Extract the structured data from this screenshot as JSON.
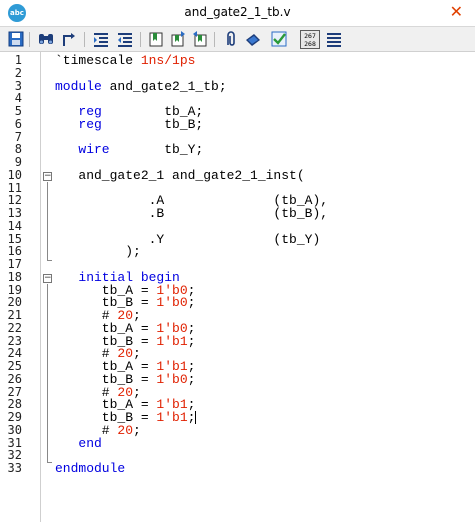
{
  "window": {
    "title": "and_gate2_1_tb.v",
    "app_icon_label": "abc"
  },
  "toolbar": {
    "counter_top": "267",
    "counter_bottom": "268"
  },
  "editor": {
    "line_numbers": [
      "1",
      "2",
      "3",
      "4",
      "5",
      "6",
      "7",
      "8",
      "9",
      "10",
      "11",
      "12",
      "13",
      "14",
      "15",
      "16",
      "17",
      "18",
      "19",
      "20",
      "21",
      "22",
      "23",
      "24",
      "25",
      "26",
      "27",
      "28",
      "29",
      "30",
      "31",
      "32",
      "33"
    ],
    "lines": [
      [
        {
          "t": "`timescale "
        },
        {
          "t": "1ns/1ps",
          "c": "num"
        }
      ],
      [],
      [
        {
          "t": "module",
          "c": "kw"
        },
        {
          "t": " and_gate2_1_tb;"
        }
      ],
      [],
      [
        {
          "t": "   "
        },
        {
          "t": "reg",
          "c": "kw"
        },
        {
          "t": "        tb_A;"
        }
      ],
      [
        {
          "t": "   "
        },
        {
          "t": "reg",
          "c": "kw"
        },
        {
          "t": "        tb_B;"
        }
      ],
      [],
      [
        {
          "t": "   "
        },
        {
          "t": "wire",
          "c": "kw"
        },
        {
          "t": "       tb_Y;"
        }
      ],
      [],
      [
        {
          "t": "   and_gate2_1 and_gate2_1_inst("
        }
      ],
      [],
      [
        {
          "t": "            .A              (tb_A),"
        }
      ],
      [
        {
          "t": "            .B              (tb_B),"
        }
      ],
      [],
      [
        {
          "t": "            .Y              (tb_Y)"
        }
      ],
      [
        {
          "t": "         );"
        }
      ],
      [],
      [
        {
          "t": "   "
        },
        {
          "t": "initial",
          "c": "kw"
        },
        {
          "t": " "
        },
        {
          "t": "begin",
          "c": "kw"
        }
      ],
      [
        {
          "t": "      tb_A = "
        },
        {
          "t": "1'b0",
          "c": "num"
        },
        {
          "t": ";"
        }
      ],
      [
        {
          "t": "      tb_B = "
        },
        {
          "t": "1'b0",
          "c": "num"
        },
        {
          "t": ";"
        }
      ],
      [
        {
          "t": "      # "
        },
        {
          "t": "20",
          "c": "num"
        },
        {
          "t": ";"
        }
      ],
      [
        {
          "t": "      tb_A = "
        },
        {
          "t": "1'b0",
          "c": "num"
        },
        {
          "t": ";"
        }
      ],
      [
        {
          "t": "      tb_B = "
        },
        {
          "t": "1'b1",
          "c": "num"
        },
        {
          "t": ";"
        }
      ],
      [
        {
          "t": "      # "
        },
        {
          "t": "20",
          "c": "num"
        },
        {
          "t": ";"
        }
      ],
      [
        {
          "t": "      tb_A = "
        },
        {
          "t": "1'b1",
          "c": "num"
        },
        {
          "t": ";"
        }
      ],
      [
        {
          "t": "      tb_B = "
        },
        {
          "t": "1'b0",
          "c": "num"
        },
        {
          "t": ";"
        }
      ],
      [
        {
          "t": "      # "
        },
        {
          "t": "20",
          "c": "num"
        },
        {
          "t": ";"
        }
      ],
      [
        {
          "t": "      tb_A = "
        },
        {
          "t": "1'b1",
          "c": "num"
        },
        {
          "t": ";"
        }
      ],
      [
        {
          "t": "      tb_B = "
        },
        {
          "t": "1'b1",
          "c": "num"
        },
        {
          "t": ";"
        },
        {
          "cursor": true
        }
      ],
      [
        {
          "t": "      # "
        },
        {
          "t": "20",
          "c": "num"
        },
        {
          "t": ";"
        }
      ],
      [
        {
          "t": "   "
        },
        {
          "t": "end",
          "c": "kw"
        }
      ],
      [],
      [
        {
          "t": "endmodule",
          "c": "kw"
        }
      ]
    ]
  },
  "colors": {
    "keyword": "#0000e0",
    "number": "#e02000",
    "close_button": "#e04000",
    "app_icon": "#2f9bd6"
  },
  "icons": [
    "app-icon",
    "close-icon",
    "save-icon",
    "binoculars-icon",
    "goto-icon",
    "indent-icon",
    "outdent-icon",
    "bookmark-icon",
    "bookmark-next-icon",
    "bookmark-prev-icon",
    "paperclip-icon",
    "paint-icon",
    "checkmark-icon",
    "line-counter-icon",
    "list-icon"
  ]
}
